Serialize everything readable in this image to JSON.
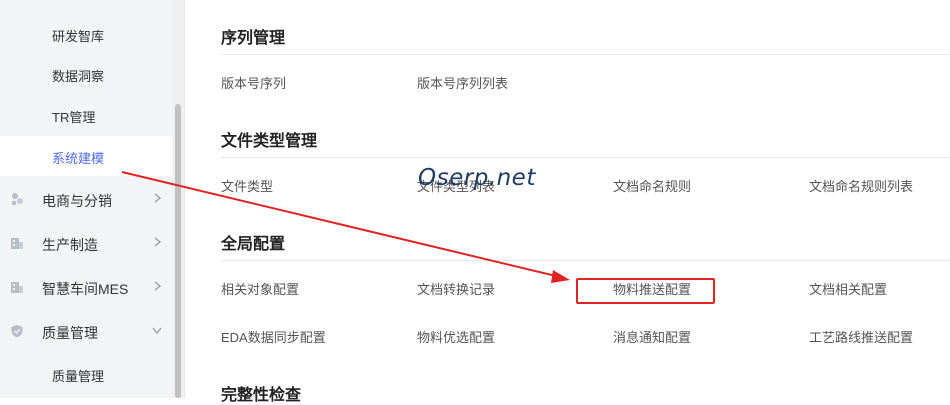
{
  "sidebar": {
    "sub_items_top": [
      {
        "label": "研发智库"
      },
      {
        "label": "数据洞察"
      },
      {
        "label": "TR管理"
      },
      {
        "label": "系统建模",
        "active": true
      }
    ],
    "groups": [
      {
        "label": "电商与分销",
        "icon": "people-icon",
        "chevron": "right"
      },
      {
        "label": "生产制造",
        "icon": "building-icon",
        "chevron": "right"
      },
      {
        "label": "智慧车间MES",
        "icon": "building-icon",
        "chevron": "right"
      },
      {
        "label": "质量管理",
        "icon": "shield-icon",
        "chevron": "down"
      }
    ],
    "sub_items_bottom": [
      {
        "label": "质量管理"
      }
    ]
  },
  "main": {
    "sections": [
      {
        "title": "序列管理",
        "items": [
          "版本号序列",
          "版本号序列列表"
        ]
      },
      {
        "title": "文件类型管理",
        "items": [
          "文件类型",
          "文件类型列表",
          "文档命名规则",
          "文档命名规则列表"
        ]
      },
      {
        "title": "全局配置",
        "items": [
          "相关对象配置",
          "文档转换记录",
          "物料推送配置",
          "文档相关配置",
          "EDA数据同步配置",
          "物料优选配置",
          "消息通知配置",
          "工艺路线推送配置"
        ]
      },
      {
        "title": "完整性检查",
        "items": []
      }
    ]
  },
  "annotation": {
    "watermark": "Oserp.net",
    "highlight_target": "物料推送配置",
    "color": "#e02424"
  },
  "colors": {
    "accent": "#4f6bf4",
    "sidebar_bg": "#f3f4f6"
  }
}
